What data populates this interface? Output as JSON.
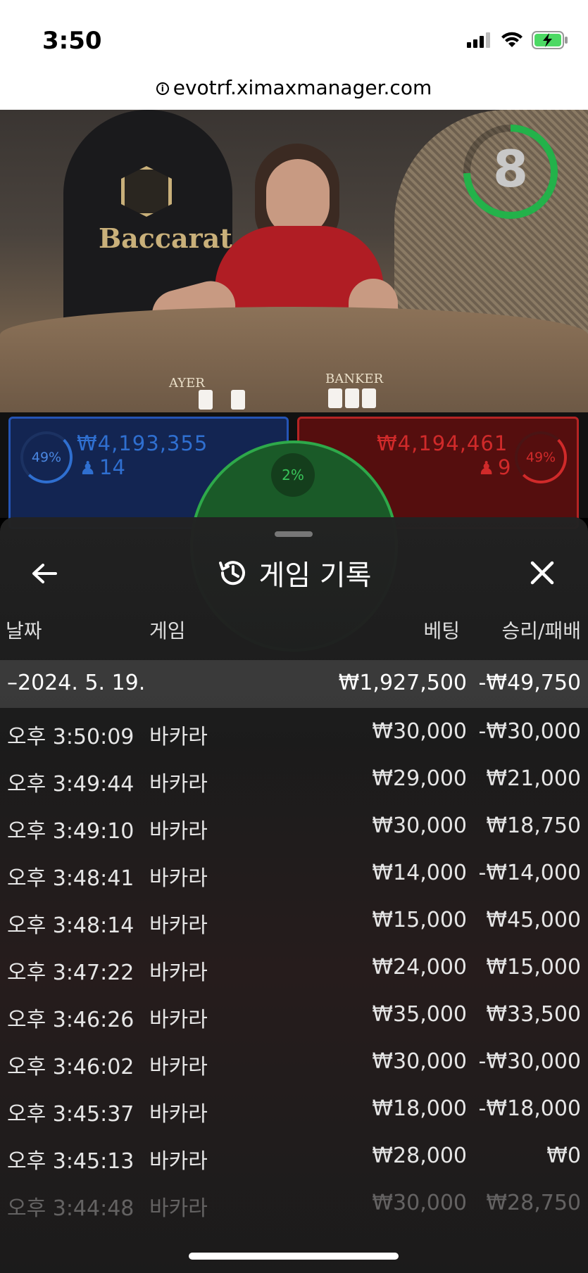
{
  "status": {
    "time": "3:50",
    "icons": [
      "signal-icon",
      "wifi-icon",
      "battery-charging-icon"
    ]
  },
  "browser": {
    "url": "evotrf.ximaxmanager.com"
  },
  "video": {
    "logo_text": "Baccarat",
    "table_labels": {
      "player": "AYER",
      "banker": "BANKER"
    },
    "timer_value": "8"
  },
  "bets": {
    "player": {
      "percent": "49%",
      "amount": "₩4,193,355",
      "count": "14"
    },
    "tie": {
      "percent": "2%"
    },
    "banker": {
      "percent": "49%",
      "amount": "₩4,194,461",
      "count": "9"
    }
  },
  "colors": {
    "player": "#2f6fd0",
    "banker": "#d02a2a",
    "tie": "#2ea94a"
  },
  "panel": {
    "title": "게임 기록",
    "title_icon": "history-icon",
    "back_icon": "arrow-left-icon",
    "close_icon": "close-icon",
    "columns": {
      "date": "날짜",
      "game": "게임",
      "bet": "베팅",
      "result": "승리/패배"
    },
    "summary": {
      "date": "–2024. 5. 19.",
      "bet": "₩1,927,500",
      "result": "-₩49,750"
    },
    "records": [
      {
        "time": "오후 3:50:09",
        "game": "바카라",
        "bet": "₩30,000",
        "result": "-₩30,000"
      },
      {
        "time": "오후 3:49:44",
        "game": "바카라",
        "bet": "₩29,000",
        "result": "₩21,000"
      },
      {
        "time": "오후 3:49:10",
        "game": "바카라",
        "bet": "₩30,000",
        "result": "₩18,750"
      },
      {
        "time": "오후 3:48:41",
        "game": "바카라",
        "bet": "₩14,000",
        "result": "-₩14,000"
      },
      {
        "time": "오후 3:48:14",
        "game": "바카라",
        "bet": "₩15,000",
        "result": "₩45,000"
      },
      {
        "time": "오후 3:47:22",
        "game": "바카라",
        "bet": "₩24,000",
        "result": "₩15,000"
      },
      {
        "time": "오후 3:46:26",
        "game": "바카라",
        "bet": "₩35,000",
        "result": "₩33,500"
      },
      {
        "time": "오후 3:46:02",
        "game": "바카라",
        "bet": "₩30,000",
        "result": "-₩30,000"
      },
      {
        "time": "오후 3:45:37",
        "game": "바카라",
        "bet": "₩18,000",
        "result": "-₩18,000"
      },
      {
        "time": "오후 3:45:13",
        "game": "바카라",
        "bet": "₩28,000",
        "result": "₩0"
      },
      {
        "time": "오후 3:44:48",
        "game": "바카라",
        "bet": "₩30,000",
        "result": "₩28,750"
      }
    ]
  }
}
